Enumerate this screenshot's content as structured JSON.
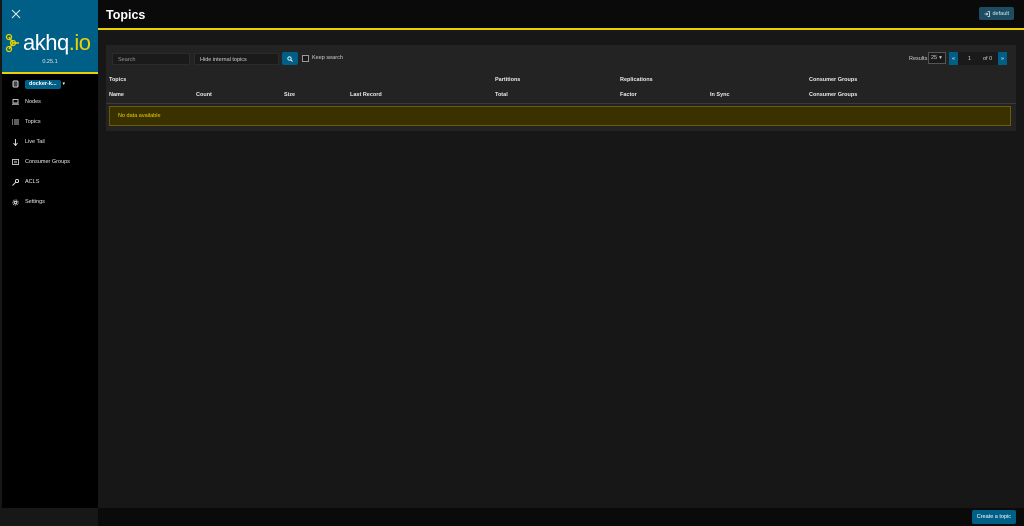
{
  "sidebar": {
    "logo_text": "akhq",
    "logo_suffix": ".io",
    "version": "0.25.1",
    "cluster": "docker-k...",
    "items": [
      {
        "label": "Nodes"
      },
      {
        "label": "Topics"
      },
      {
        "label": "Live Tail"
      },
      {
        "label": "Consumer Groups"
      },
      {
        "label": "ACLS"
      },
      {
        "label": "Settings"
      }
    ]
  },
  "header": {
    "title": "Topics",
    "default_label": "default"
  },
  "toolbar": {
    "search_placeholder": "Search",
    "filter_value": "Hide internal topics",
    "keep_search_label": "Keep search",
    "results_label": "Results",
    "results_value": "25",
    "page_current": "1",
    "page_total": "of 0"
  },
  "table": {
    "group_headers": [
      "Topics",
      "Partitions",
      "Replications",
      "Consumer Groups"
    ],
    "columns": [
      "Name",
      "Count",
      "Size",
      "Last Record",
      "Total",
      "Factor",
      "In Sync",
      "Consumer Groups"
    ],
    "empty_message": "No data available"
  },
  "footer": {
    "create_label": "Create a topic"
  },
  "colors": {
    "accent": "#005f87",
    "highlight": "#ead200",
    "background": "#171717"
  }
}
